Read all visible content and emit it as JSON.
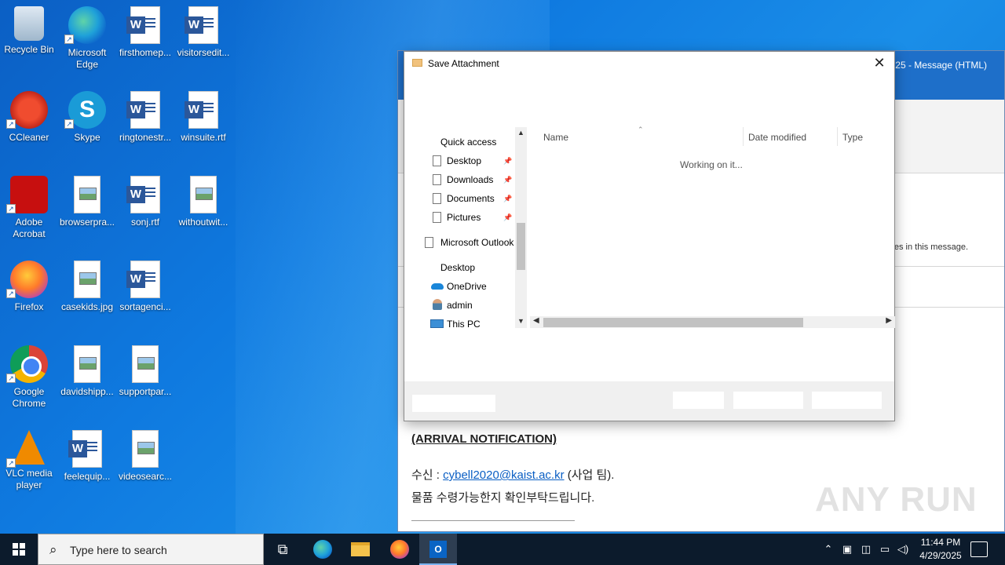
{
  "desktop": {
    "icons": [
      {
        "label": "Recycle Bin",
        "icon": "recycle-bin-icon"
      },
      {
        "label": "Microsoft Edge",
        "icon": "edge-icon"
      },
      {
        "label": "firsthomep...",
        "icon": "word-document-icon"
      },
      {
        "label": "visitorsedit...",
        "icon": "word-document-icon"
      },
      {
        "label": "CCleaner",
        "icon": "ccleaner-icon"
      },
      {
        "label": "Skype",
        "icon": "skype-icon"
      },
      {
        "label": "ringtonestr...",
        "icon": "word-document-icon"
      },
      {
        "label": "winsuite.rtf",
        "icon": "word-document-icon"
      },
      {
        "label": "Adobe Acrobat",
        "icon": "acrobat-icon"
      },
      {
        "label": "browserpra...",
        "icon": "image-file-icon"
      },
      {
        "label": "sonj.rtf",
        "icon": "word-document-icon"
      },
      {
        "label": "withoutwit...",
        "icon": "image-file-icon"
      },
      {
        "label": "Firefox",
        "icon": "firefox-icon"
      },
      {
        "label": "casekids.jpg",
        "icon": "image-file-icon"
      },
      {
        "label": "sortagenci...",
        "icon": "word-document-icon"
      },
      {
        "label": "Google Chrome",
        "icon": "chrome-icon"
      },
      {
        "label": "davidshipp...",
        "icon": "image-file-icon"
      },
      {
        "label": "supportpar...",
        "icon": "image-file-icon"
      },
      {
        "label": "VLC media player",
        "icon": "vlc-icon"
      },
      {
        "label": "feelequip...",
        "icon": "word-document-icon"
      },
      {
        "label": "videosearc...",
        "icon": "image-file-icon"
      }
    ]
  },
  "outlook": {
    "title": "25 - Message (HTML)",
    "info_text": "es in this message.",
    "heading": "(ARRIVAL NOTIFICATION)",
    "recipient_prefix": "수신 : ",
    "recipient_email": "cybell2020@kaist.ac.kr",
    "recipient_suffix": " (사업 팀).",
    "body_line": "물품 수령가능한지 확인부탁드립니다."
  },
  "dialog": {
    "title": "Save Attachment",
    "close": "✕",
    "nav": {
      "quick_access": "Quick access",
      "desktop": "Desktop",
      "downloads": "Downloads",
      "documents": "Documents",
      "pictures": "Pictures",
      "outlook": "Microsoft Outlook",
      "desktop_root": "Desktop",
      "onedrive": "OneDrive",
      "admin": "admin",
      "this_pc": "This PC"
    },
    "columns": {
      "name": "Name",
      "date_modified": "Date modified",
      "type": "Type"
    },
    "status": "Working on it..."
  },
  "taskbar": {
    "search_placeholder": "Type here to search",
    "time": "11:44 PM",
    "date": "4/29/2025"
  },
  "watermark": "ANY RUN"
}
